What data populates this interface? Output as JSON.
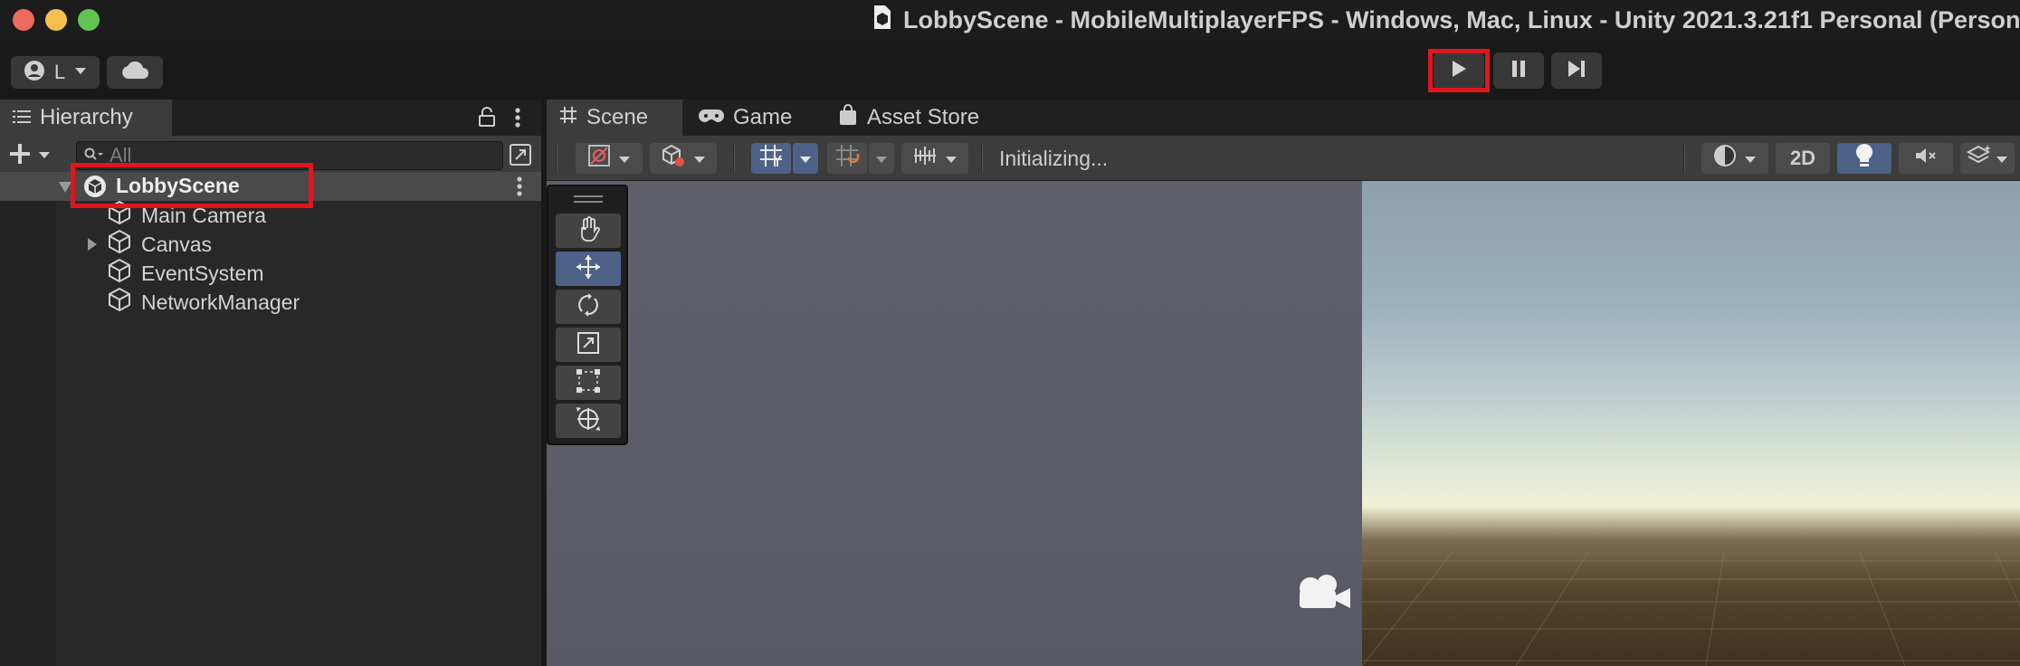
{
  "window": {
    "title": "LobbyScene - MobileMultiplayerFPS - Windows, Mac, Linux - Unity 2021.3.21f1 Personal (Personal)"
  },
  "main_toolbar": {
    "account_label": "L",
    "account_icon": "account-icon",
    "cloud_icon": "cloud-icon",
    "play_icon": "play-icon",
    "pause_icon": "pause-icon",
    "step_icon": "step-icon"
  },
  "hierarchy": {
    "tab_label": "Hierarchy",
    "search_placeholder": "All",
    "scene_name": "LobbyScene",
    "items": [
      {
        "label": "Main Camera",
        "has_children": false
      },
      {
        "label": "Canvas",
        "has_children": true
      },
      {
        "label": "EventSystem",
        "has_children": false
      },
      {
        "label": "NetworkManager",
        "has_children": false
      }
    ]
  },
  "scene_panel": {
    "tabs": [
      {
        "label": "Scene",
        "icon": "hash-icon",
        "active": true
      },
      {
        "label": "Game",
        "icon": "gamepad-icon",
        "active": false
      },
      {
        "label": "Asset Store",
        "icon": "shopping-bag-icon",
        "active": false
      }
    ],
    "status_text": "Initializing...",
    "mode_2d_label": "2D"
  },
  "colors": {
    "highlight": "#e0161e",
    "active_button": "#4d6286"
  }
}
